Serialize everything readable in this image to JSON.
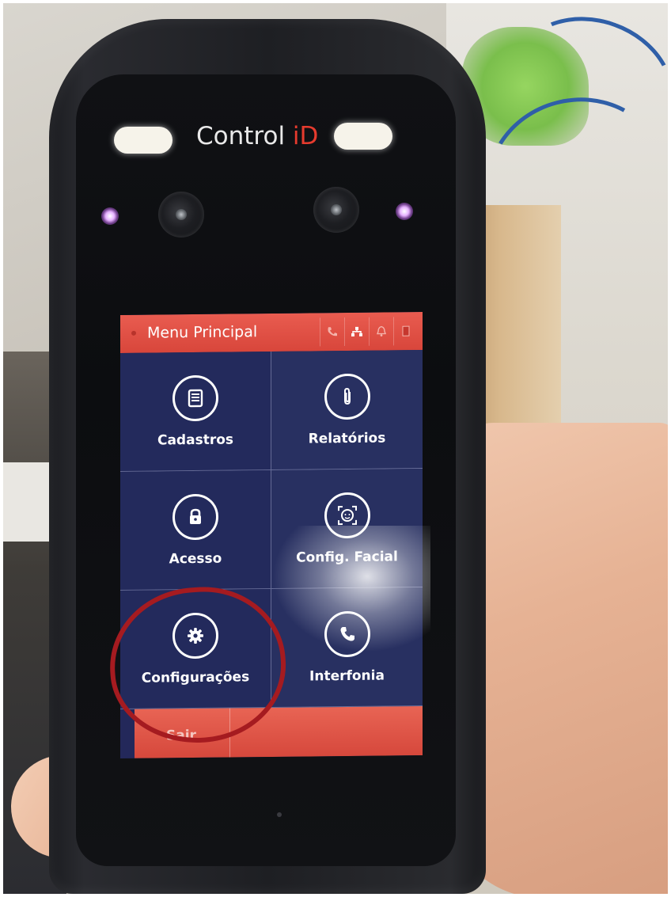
{
  "device": {
    "brand_main": "Control ",
    "brand_accent": "iD"
  },
  "menu": {
    "title": "Menu Principal",
    "header_icons": [
      {
        "name": "phone-icon",
        "glyph": "✆"
      },
      {
        "name": "network-icon",
        "glyph": "⚘"
      },
      {
        "name": "bell-icon",
        "glyph": "♫"
      },
      {
        "name": "door-icon",
        "glyph": "▮"
      }
    ],
    "tiles": [
      {
        "label": "Cadastros",
        "icon": "list-icon"
      },
      {
        "label": "Relatórios",
        "icon": "paperclip-icon"
      },
      {
        "label": "Acesso",
        "icon": "lock-icon"
      },
      {
        "label": "Config. Facial",
        "icon": "face-scan-icon"
      },
      {
        "label": "Configurações",
        "icon": "gear-icon"
      },
      {
        "label": "Interfonia",
        "icon": "phone-icon"
      }
    ],
    "footer_label": "Sair"
  },
  "annotation": {
    "highlight_color": "#a51b20",
    "highlighted_item": "Configurações"
  },
  "colors": {
    "header": "#e95c50",
    "tile_bg": "#232a5c",
    "accent": "#e63b2e"
  }
}
